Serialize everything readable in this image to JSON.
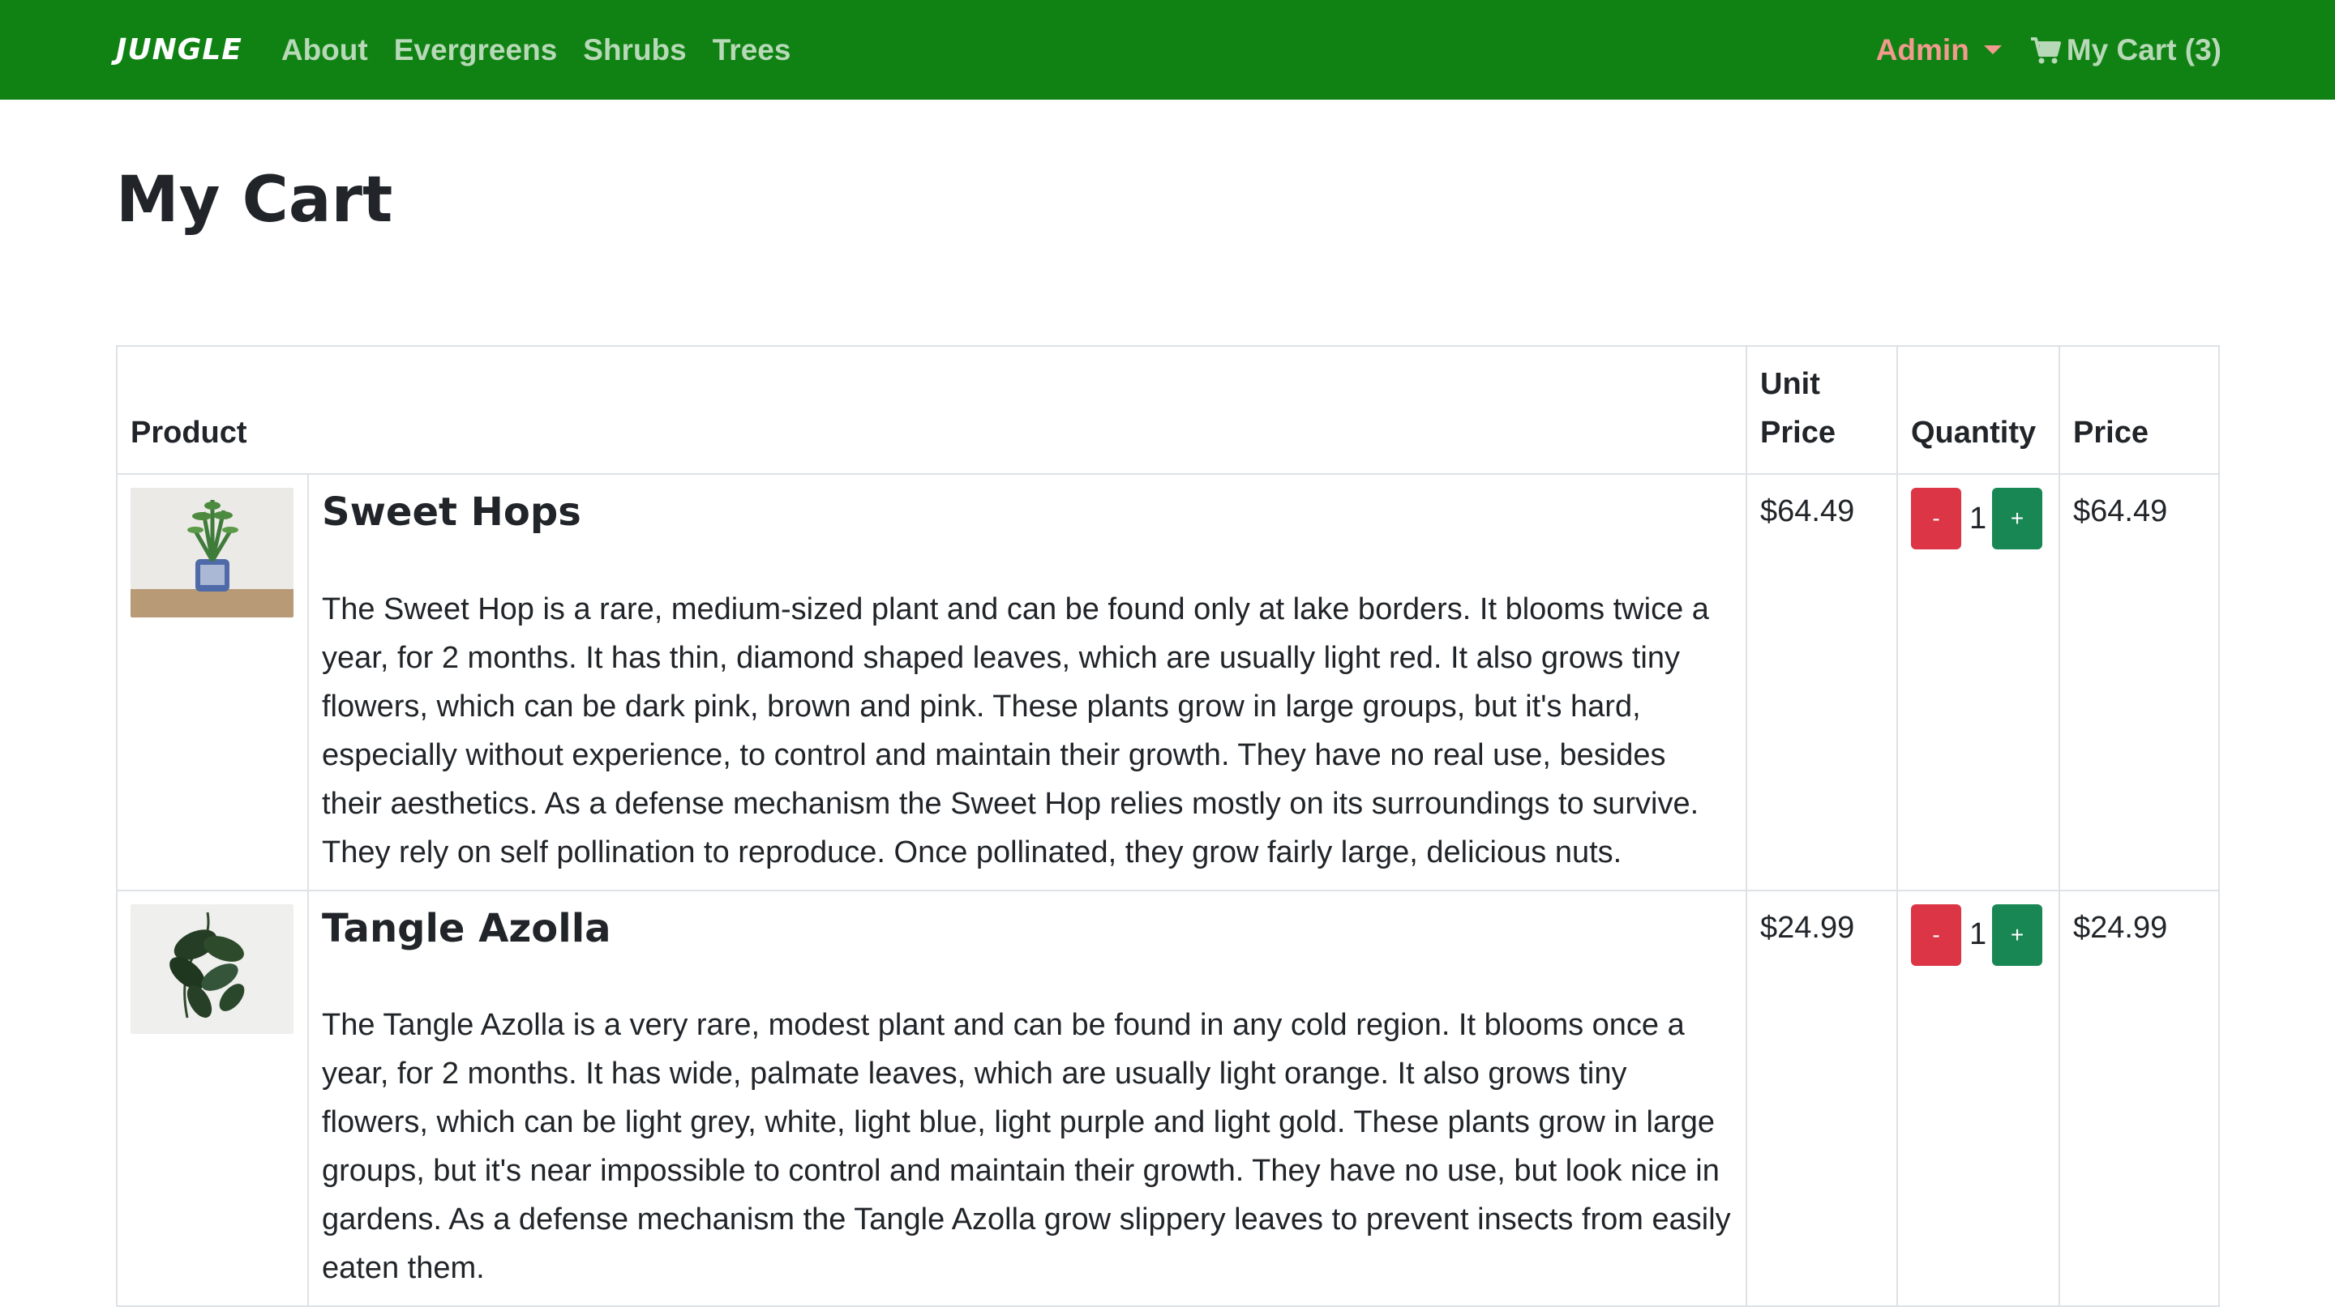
{
  "nav": {
    "brand": "JUNGLE",
    "links": [
      "About",
      "Evergreens",
      "Shrubs",
      "Trees"
    ],
    "admin_label": "Admin",
    "cart_label": "My Cart (3)"
  },
  "page": {
    "title": "My Cart"
  },
  "table": {
    "headers": {
      "product": "Product",
      "unit_price": "Unit Price",
      "quantity": "Quantity",
      "price": "Price"
    },
    "rows": [
      {
        "name": "Sweet Hops",
        "description": "The Sweet Hop is a rare, medium-sized plant and can be found only at lake borders. It blooms twice a year, for 2 months. It has thin, diamond shaped leaves, which are usually light red. It also grows tiny flowers, which can be dark pink, brown and pink. These plants grow in large groups, but it's hard, especially without experience, to control and maintain their growth. They have no real use, besides their aesthetics. As a defense mechanism the Sweet Hop relies mostly on its surroundings to survive. They rely on self pollination to reproduce. Once pollinated, they grow fairly large, delicious nuts.",
        "unit_price": "$64.49",
        "quantity": "1",
        "price": "$64.49",
        "minus_label": "-",
        "plus_label": "+"
      },
      {
        "name": "Tangle Azolla",
        "description": "The Tangle Azolla is a very rare, modest plant and can be found in any cold region. It blooms once a year, for 2 months. It has wide, palmate leaves, which are usually light orange. It also grows tiny flowers, which can be light grey, white, light blue, light purple and light gold. These plants grow in large groups, but it's near impossible to control and maintain their growth. They have no use, but look nice in gardens. As a defense mechanism the Tangle Azolla grow slippery leaves to prevent insects from easily eaten them.",
        "unit_price": "$24.99",
        "quantity": "1",
        "price": "$24.99",
        "minus_label": "-",
        "plus_label": "+"
      }
    ]
  },
  "colors": {
    "navbar": "#108213",
    "minus": "#dc3545",
    "plus": "#198754",
    "admin": "#f29a8d"
  }
}
